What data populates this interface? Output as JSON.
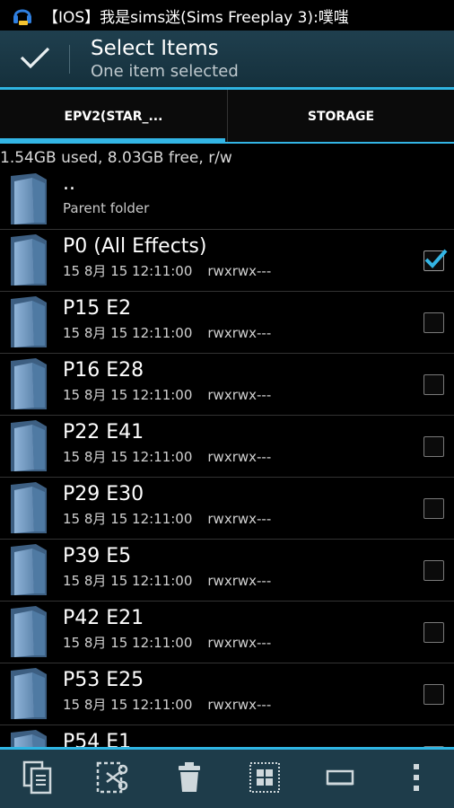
{
  "status_bar": {
    "notification_icon": "headset-notification-icon",
    "text": "【IOS】我是sims迷(Sims Freeplay 3):噗嗤"
  },
  "action_bar": {
    "done_icon": "checkmark-icon",
    "title": "Select Items",
    "subtitle": "One item selected"
  },
  "tabs": [
    {
      "label": "EPV2(STAR_...",
      "active": true
    },
    {
      "label": "STORAGE",
      "active": false
    }
  ],
  "storage_info": "1.54GB used, 8.03GB free, r/w",
  "parent_folder": {
    "name": "..",
    "label": "Parent folder"
  },
  "files": [
    {
      "name": "P0 (All Effects)",
      "date": "15 8月 15 12:11:00",
      "perm": "rwxrwx---",
      "checked": true
    },
    {
      "name": "P15 E2",
      "date": "15 8月 15 12:11:00",
      "perm": "rwxrwx---",
      "checked": false
    },
    {
      "name": "P16 E28",
      "date": "15 8月 15 12:11:00",
      "perm": "rwxrwx---",
      "checked": false
    },
    {
      "name": "P22 E41",
      "date": "15 8月 15 12:11:00",
      "perm": "rwxrwx---",
      "checked": false
    },
    {
      "name": "P29 E30",
      "date": "15 8月 15 12:11:00",
      "perm": "rwxrwx---",
      "checked": false
    },
    {
      "name": "P39 E5",
      "date": "15 8月 15 12:11:00",
      "perm": "rwxrwx---",
      "checked": false
    },
    {
      "name": "P42 E21",
      "date": "15 8月 15 12:11:00",
      "perm": "rwxrwx---",
      "checked": false
    },
    {
      "name": "P53 E25",
      "date": "15 8月 15 12:11:00",
      "perm": "rwxrwx---",
      "checked": false
    },
    {
      "name": "P54 E1",
      "date": "",
      "perm": "",
      "checked": false
    }
  ],
  "bottom_bar": [
    {
      "icon": "copy-icon"
    },
    {
      "icon": "cut-icon"
    },
    {
      "icon": "delete-icon"
    },
    {
      "icon": "select-all-icon"
    },
    {
      "icon": "rename-icon"
    },
    {
      "icon": "overflow-menu-icon"
    }
  ],
  "colors": {
    "accent": "#33b5e5",
    "actionbar_bg": "#1f3f4e",
    "bottombar_bg": "#1e3c4a"
  }
}
